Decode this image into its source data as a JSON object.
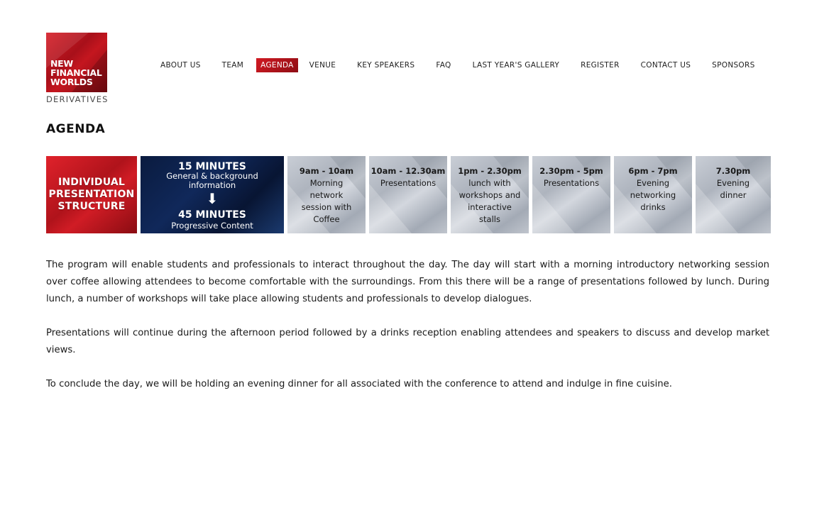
{
  "logo": {
    "line1": "NEW",
    "line2": "FINANCIAL",
    "line3": "WORLDS",
    "subtitle": "DERIVATIVES"
  },
  "nav": {
    "items": [
      {
        "label": "ABOUT US",
        "active": false
      },
      {
        "label": "TEAM",
        "active": false
      },
      {
        "label": "AGENDA",
        "active": true
      },
      {
        "label": "VENUE",
        "active": false
      },
      {
        "label": "KEY SPEAKERS",
        "active": false
      },
      {
        "label": "FAQ",
        "active": false
      },
      {
        "label": "LAST YEAR'S GALLERY",
        "active": false
      },
      {
        "label": "REGISTER",
        "active": false
      },
      {
        "label": "CONTACT US",
        "active": false
      },
      {
        "label": "SPONSORS",
        "active": false
      }
    ],
    "active_color": "#c4161f"
  },
  "page": {
    "title": "AGENDA"
  },
  "banner": {
    "structure": {
      "line1": "INDIVIDUAL",
      "line2": "PRESENTATION",
      "line3": "STRUCTURE"
    },
    "format": {
      "heading1": "15 MINUTES",
      "sub1a": "General & background",
      "sub1b": "information",
      "arrow": "⬇",
      "heading2": "45 MINUTES",
      "sub2": "Progressive Content"
    },
    "schedule": [
      {
        "time": "9am - 10am",
        "desc": [
          "Morning",
          "network",
          "session with",
          "Coffee"
        ]
      },
      {
        "time": "10am - 12.30am",
        "desc": [
          "Presentations"
        ]
      },
      {
        "time": "1pm - 2.30pm",
        "desc": [
          "lunch with",
          "workshops and",
          "interactive",
          "stalls"
        ]
      },
      {
        "time": "2.30pm - 5pm",
        "desc": [
          "Presentations"
        ]
      },
      {
        "time": "6pm - 7pm",
        "desc": [
          "Evening",
          "networking",
          "drinks"
        ]
      },
      {
        "time": "7.30pm",
        "desc": [
          "Evening",
          "dinner"
        ]
      }
    ],
    "colors": {
      "red": "#c4161f",
      "navy": "#0e2450",
      "grey": "#b7bcc5"
    }
  },
  "content": {
    "paragraphs": [
      "The program will enable students and professionals to interact throughout the day. The day will start with a morning introductory networking session over coffee allowing attendees to become comfortable with the surroundings. From this there will be a range of presentations followed by lunch. During lunch, a number of workshops will take place allowing students and professionals to develop dialogues.",
      "Presentations will continue during the afternoon period followed by a drinks reception enabling attendees and speakers to discuss and develop market views.",
      "To conclude the day, we will be holding an evening dinner for all associated with the conference to attend and indulge in fine cuisine."
    ]
  }
}
